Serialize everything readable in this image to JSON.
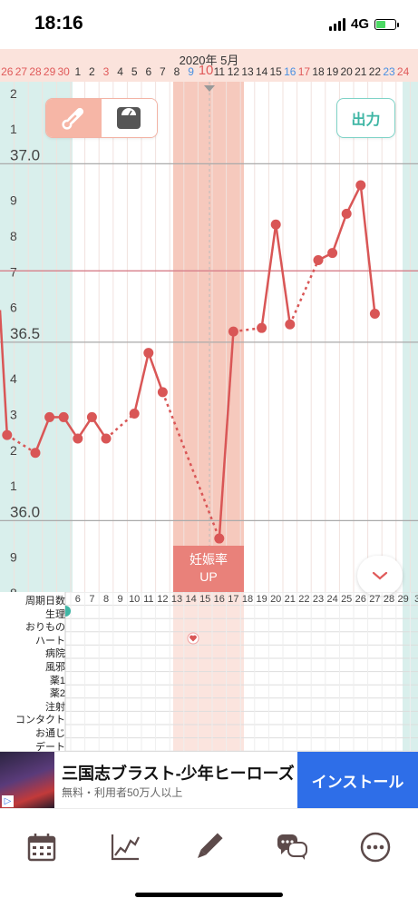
{
  "status_bar": {
    "time": "18:16",
    "network": "4G",
    "battery_level": 0.5
  },
  "header": {
    "month": "2020年 5月",
    "selected_day": "10",
    "days": [
      "26",
      "27",
      "28",
      "29",
      "30",
      "1",
      "2",
      "3",
      "4",
      "5",
      "6",
      "7",
      "8",
      "9",
      "10",
      "11",
      "12",
      "13",
      "14",
      "15",
      "16",
      "17",
      "18",
      "19",
      "20",
      "21",
      "22",
      "23",
      "24"
    ],
    "day_colors": {
      "saturday": "#4a90e2",
      "sunday": "#e05a5a",
      "weekday": "#333333",
      "selected": "#e05a5a"
    }
  },
  "toolbar": {
    "export_label": "出力",
    "mode_thermometer": "thermometer-icon",
    "mode_scale": "scale-icon"
  },
  "y_axis": {
    "major_labels": [
      "37.0",
      "36.5",
      "36.0"
    ],
    "minor_labels": [
      "2",
      "1",
      "9",
      "8",
      "7",
      "6",
      "4",
      "3",
      "2",
      "1",
      "9",
      "8"
    ]
  },
  "phase_badge": {
    "line1": "妊娠率",
    "line2": "UP"
  },
  "chart_data": {
    "type": "line",
    "xlabel": "",
    "ylabel": "",
    "ylim": [
      35.8,
      37.23
    ],
    "x": [
      "4/26",
      "4/27",
      "4/28",
      "4/29",
      "4/30",
      "5/1",
      "5/2",
      "5/3",
      "5/4",
      "5/5",
      "5/6",
      "5/7",
      "5/8",
      "5/9",
      "5/10",
      "5/11",
      "5/12",
      "5/13",
      "5/14",
      "5/15",
      "5/16",
      "5/17",
      "5/18",
      "5/19",
      "5/20",
      "5/21",
      "5/22",
      "5/23",
      "5/24"
    ],
    "series": [
      {
        "values": [
          36.24,
          null,
          36.19,
          36.29,
          36.29,
          36.23,
          36.29,
          36.23,
          null,
          36.3,
          36.47,
          36.36,
          null,
          null,
          null,
          35.95,
          36.53,
          null,
          36.54,
          36.83,
          36.55,
          null,
          36.73,
          36.75,
          36.86,
          36.94,
          36.58,
          null,
          null
        ]
      }
    ],
    "coverline": 36.7,
    "annotations": [
      "妊娠率 UP"
    ]
  },
  "grid_table": {
    "rows": [
      "周期日数",
      "生理",
      "おりもの",
      "ハート",
      "病院",
      "風邪",
      "薬1",
      "薬2",
      "注射",
      "コンタクト",
      "お通じ",
      "デート"
    ],
    "cycle_days": [
      "6",
      "7",
      "8",
      "9",
      "10",
      "11",
      "12",
      "13",
      "14",
      "15",
      "16",
      "17",
      "18",
      "19",
      "20",
      "21",
      "22",
      "23",
      "24",
      "25",
      "26",
      "27",
      "28",
      "29",
      "3"
    ]
  },
  "ad": {
    "title": "三国志ブラスト-少年ヒーローズ",
    "subtitle": "無料・利用者50万人以上",
    "button": "インストール"
  },
  "tab_bar": {
    "items": [
      "calendar-icon",
      "graph-icon",
      "pencil-icon",
      "chat-icon",
      "more-icon"
    ]
  },
  "colors": {
    "accent": "#e05a5a",
    "teal": "#3fb6a5",
    "menstruation_band": "#d9efec",
    "fertile_band": "#f6c9bd",
    "line": "#d95656"
  }
}
